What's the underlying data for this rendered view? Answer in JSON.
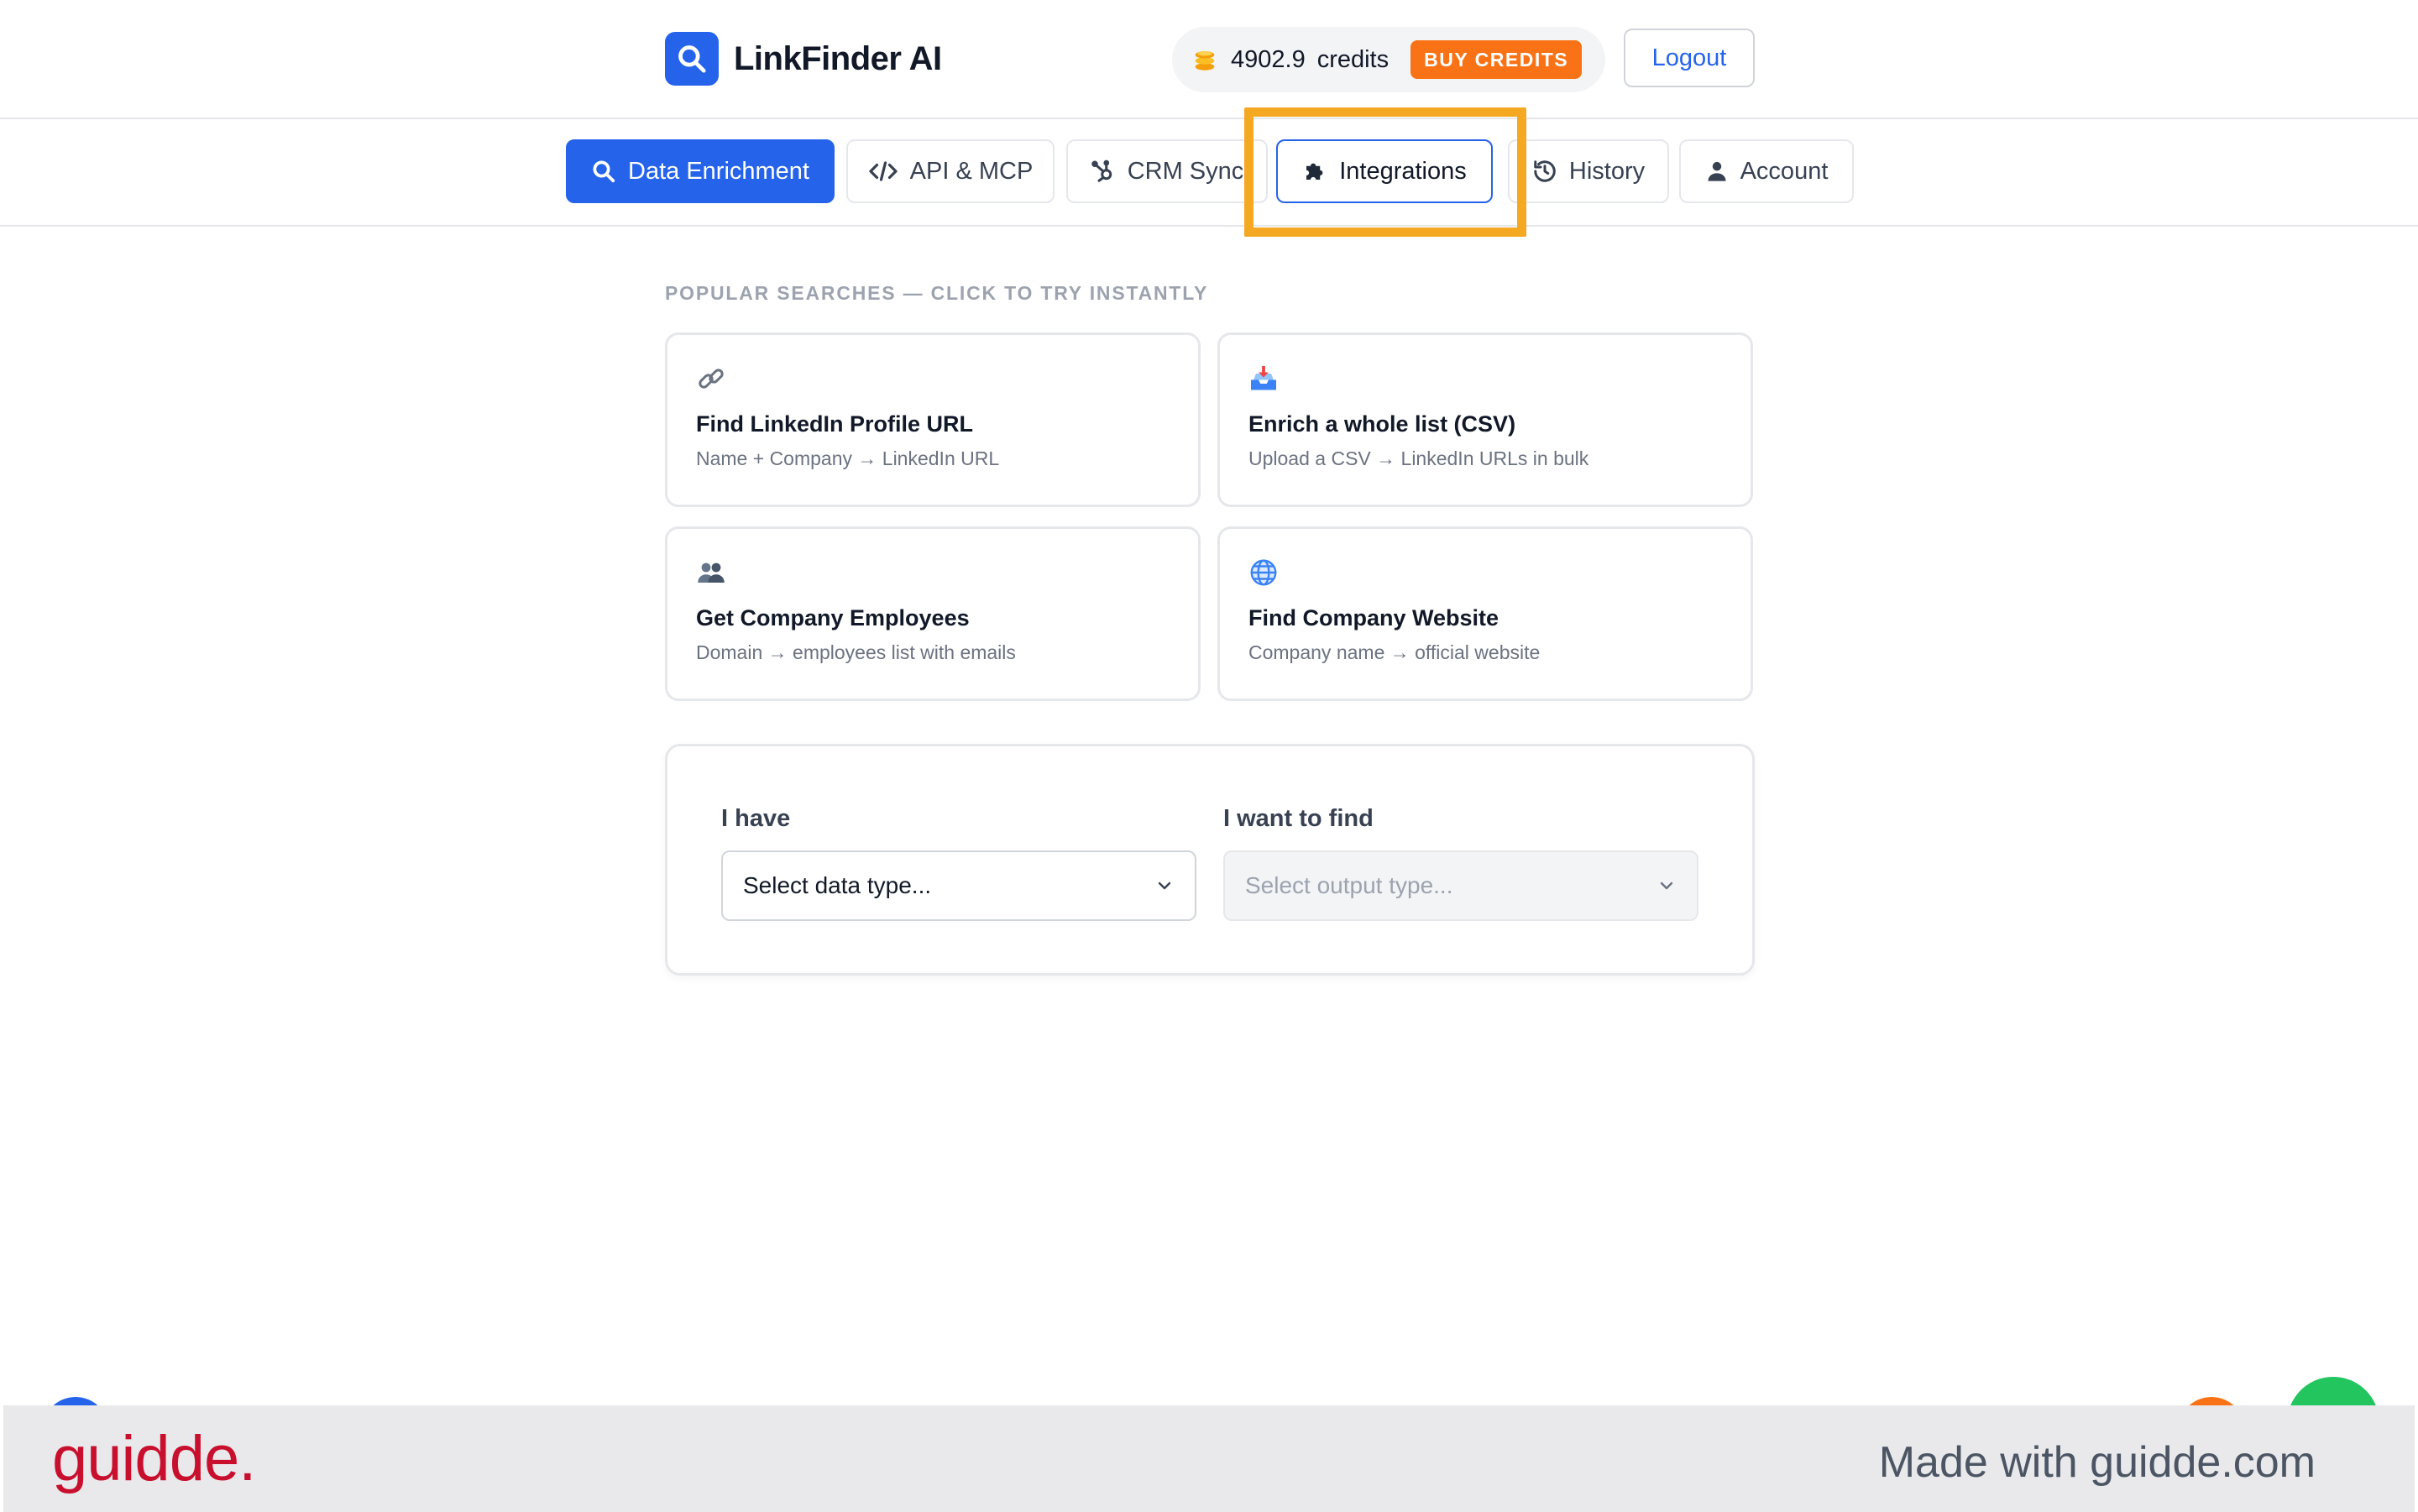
{
  "header": {
    "app_name": "LinkFinder AI",
    "logo_icon": "search-icon",
    "credits_amount": "4902.9",
    "credits_unit": "credits",
    "buy_credits_label": "BUY CREDITS",
    "logout_label": "Logout"
  },
  "tabs": [
    {
      "label": "Data Enrichment",
      "icon": "search-icon",
      "state": "active"
    },
    {
      "label": "API & MCP",
      "icon": "code-icon",
      "state": "default"
    },
    {
      "label": "CRM Sync",
      "icon": "hubspot-icon",
      "state": "default"
    },
    {
      "label": "Integrations",
      "icon": "puzzle-icon",
      "state": "selected"
    },
    {
      "label": "History",
      "icon": "history-icon",
      "state": "default"
    },
    {
      "label": "Account",
      "icon": "user-icon",
      "state": "default"
    }
  ],
  "popular": {
    "title": "POPULAR SEARCHES — CLICK TO TRY INSTANTLY",
    "cards": [
      {
        "icon": "link-icon",
        "title": "Find LinkedIn Profile URL",
        "desc": "Name + Company → LinkedIn URL"
      },
      {
        "icon": "inbox-tray-icon",
        "title": "Enrich a whole list (CSV)",
        "desc": "Upload a CSV → LinkedIn URLs in bulk"
      },
      {
        "icon": "people-icon",
        "title": "Get Company Employees",
        "desc": "Domain → employees list with emails"
      },
      {
        "icon": "globe-icon",
        "title": "Find Company Website",
        "desc": "Company name → official website"
      }
    ]
  },
  "form": {
    "have_label": "I have",
    "have_placeholder": "Select data type...",
    "find_label": "I want to find",
    "find_placeholder": "Select output type..."
  },
  "footer": {
    "brand": "guidde.",
    "made_with": "Made with guidde.com"
  },
  "colors": {
    "primary": "#2563eb",
    "accent_orange": "#f97316",
    "highlight": "#f5a821",
    "guidde_red": "#c8102e"
  }
}
